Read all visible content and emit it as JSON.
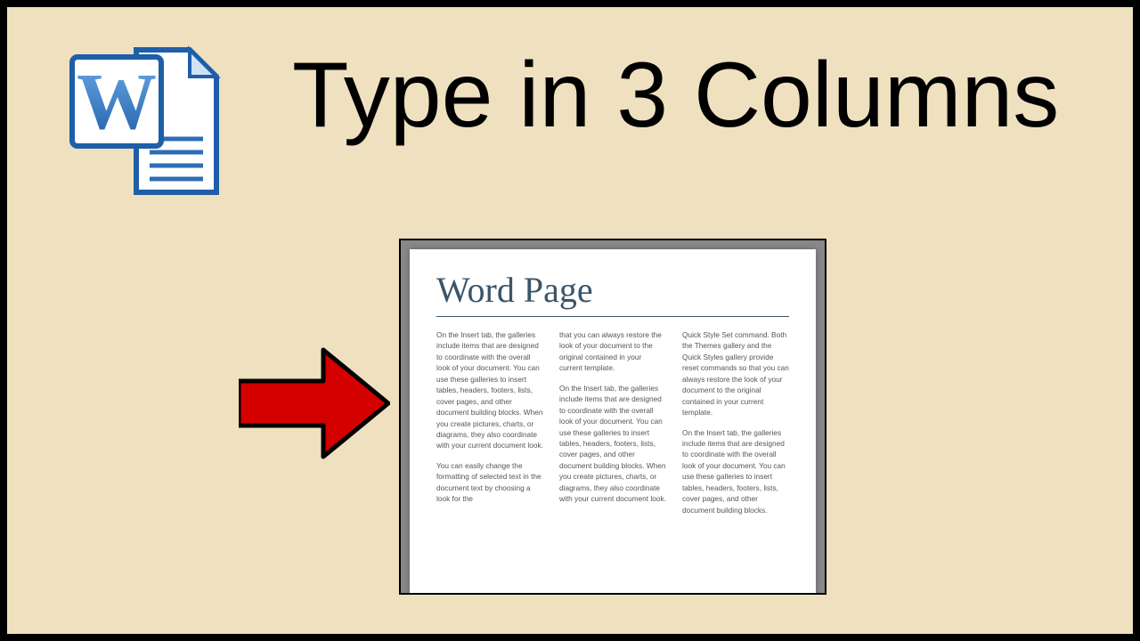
{
  "title": "Type in 3 Columns",
  "doc": {
    "heading": "Word Page",
    "col1": {
      "p1": "On the Insert tab, the galleries include items that are designed to coordinate with the overall look of your document. You can use these galleries to insert tables, headers, footers, lists, cover pages, and other document building blocks. When you create pictures, charts, or diagrams, they also coordinate with your current document look.",
      "p2": "You can easily change the formatting of selected text in the document text by choosing a look for the"
    },
    "col2": {
      "p1": "that you can always restore the look of your document to the original contained in your current template.",
      "p2": "On the Insert tab, the galleries include items that are designed to coordinate with the overall look of your document. You can use these galleries to insert tables, headers, footers, lists, cover pages, and other document building blocks. When you create pictures, charts, or diagrams, they also coordinate with your current document look."
    },
    "col3": {
      "p1": "Quick Style Set command. Both the Themes gallery and the Quick Styles gallery provide reset commands so that you can always restore the look of your document to the original contained in your current template.",
      "p2": "On the Insert tab, the galleries include items that are designed to coordinate with the overall look of your document. You can use these galleries to insert tables, headers, footers, lists, cover pages, and other document building blocks."
    }
  }
}
